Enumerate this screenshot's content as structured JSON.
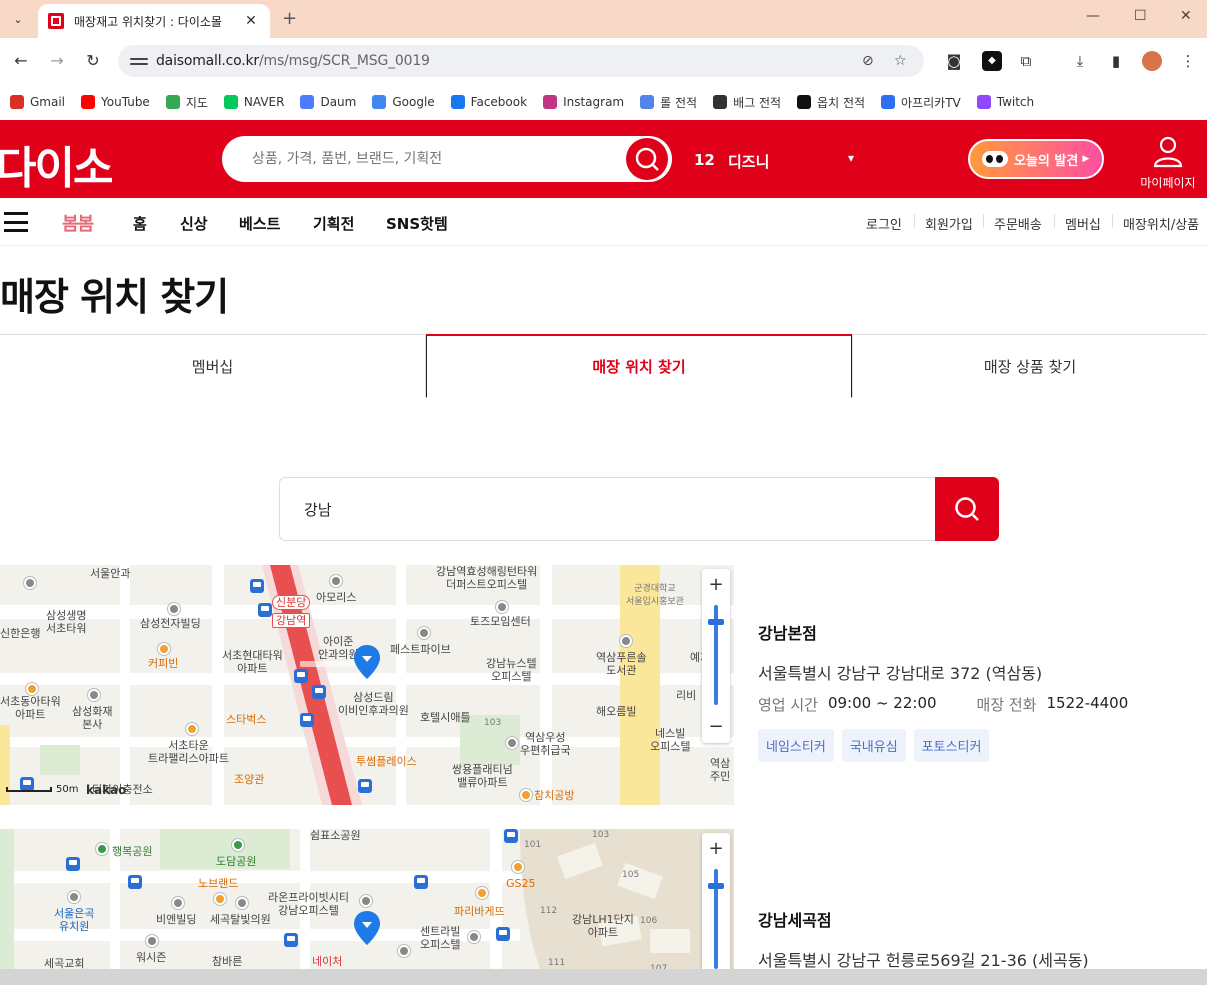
{
  "browser": {
    "tab_title": "매장재고 위치찾기 : 다이소몰",
    "url_host": "daisomall.co.kr",
    "url_path": "/ms/msg/SCR_MSG_0019",
    "bookmarks": [
      {
        "label": "Gmail",
        "color": "#d93025"
      },
      {
        "label": "YouTube",
        "color": "#ff0000"
      },
      {
        "label": "지도",
        "color": "#34a853"
      },
      {
        "label": "NAVER",
        "color": "#03c75a"
      },
      {
        "label": "Daum",
        "color": "#4f7cff"
      },
      {
        "label": "Google",
        "color": "#4285f4"
      },
      {
        "label": "Facebook",
        "color": "#1877f2"
      },
      {
        "label": "Instagram",
        "color": "#c13584"
      },
      {
        "label": "롤 전적",
        "color": "#5383e8"
      },
      {
        "label": "배그 전적",
        "color": "#333333"
      },
      {
        "label": "옵치 전적",
        "color": "#111111"
      },
      {
        "label": "아프리카TV",
        "color": "#2e6ff2"
      },
      {
        "label": "Twitch",
        "color": "#9146ff"
      }
    ]
  },
  "header": {
    "logo": "다이소",
    "search_placeholder": "상품, 가격, 품번, 브랜드, 기획전",
    "trend_rank": "12",
    "trend_term": "디즈니",
    "today_button": "오늘의 발견",
    "mypage": "마이페이지"
  },
  "nav": {
    "event_logo": "봄봄",
    "items": [
      "홈",
      "신상",
      "베스트",
      "기획전",
      "SNS핫템"
    ],
    "util_links": [
      "로그인",
      "회원가입",
      "주문배송",
      "멤버십",
      "매장위치/상품"
    ]
  },
  "page": {
    "title": "매장 위치 찾기",
    "tabs": [
      "멤버십",
      "매장 위치 찾기",
      "매장 상품 찾기"
    ],
    "search_value": "강남"
  },
  "stores": [
    {
      "name": "강남본점",
      "address": "서울특별시 강남구 강남대로 372 (역삼동)",
      "hours_label": "영업 시간",
      "hours": "09:00 ~ 22:00",
      "phone_label": "매장 전화",
      "phone": "1522-4400",
      "tags": [
        "네임스티커",
        "국내유심",
        "포토스티커"
      ]
    },
    {
      "name": "강남세곡점",
      "address": "서울특별시 강남구 헌릉로569길 21-36 (세곡동)"
    }
  ],
  "map1": {
    "scale": "50m",
    "brand": "kakao",
    "labels": {
      "l1": "서울안과",
      "l2": "삼성생명\n서초타워",
      "l3": "신한은행",
      "l4": "삼성전자빌딩",
      "l5": "커피빈",
      "l6": "서초동아타워\n아파트",
      "l7": "삼성화재\n본사",
      "l8": "서초현대타워\n아파트",
      "l9": "스타벅스",
      "l10": "서초타운\n트라팰리스아파트",
      "l11": "조양관",
      "l12": "신분당",
      "l13": "강남역",
      "l14": "아모리스",
      "l15": "아이준\n안과의원",
      "l16": "삼성드림\n이비인후과의원",
      "l17": "투썸플레이스",
      "l18": "강남역효성해링턴타워\n더퍼스트오피스텔",
      "l19": "페스트파이브",
      "l20": "토즈모임센터",
      "l21": "강남뉴스텔\n오피스텔",
      "l22": "호텔시애틀",
      "l23": "역삼우성\n우편취급국",
      "l24": "쌍용플래티넘\n밸류아파트",
      "l25": "참치공방",
      "l26": "역삼푸른솔\n도서관",
      "l27": "해오름빌",
      "l28": "네스빌\n오피스텔",
      "l29": "군경대학교\n서울입시홍보관",
      "l30": "리비",
      "l31": "역삼\n주민",
      "l32": "예지",
      "l33": "103",
      "l34": "티파이충전소"
    }
  },
  "map2": {
    "labels": {
      "m1": "행복공원",
      "m2": "도담공원",
      "m3": "쉼표소공원",
      "m4": "서울은곡\n유치원",
      "m5": "노브랜드",
      "m6": "비엔빌딩",
      "m7": "세곡탈빛의원",
      "m8": "라온프라이빗시티\n강남오피스텔",
      "m9": "파리바게뜨",
      "m10": "GS25",
      "m11": "센트라빌\n오피스텔",
      "m12": "강남LH1단지\n아파트",
      "m13": "워시즌",
      "m14": "참바른",
      "m15": "세곡교회",
      "m16": "네이처",
      "m17": "103",
      "m18": "101",
      "m19": "105",
      "m20": "112",
      "m21": "106",
      "m22": "111",
      "m23": "107"
    }
  }
}
